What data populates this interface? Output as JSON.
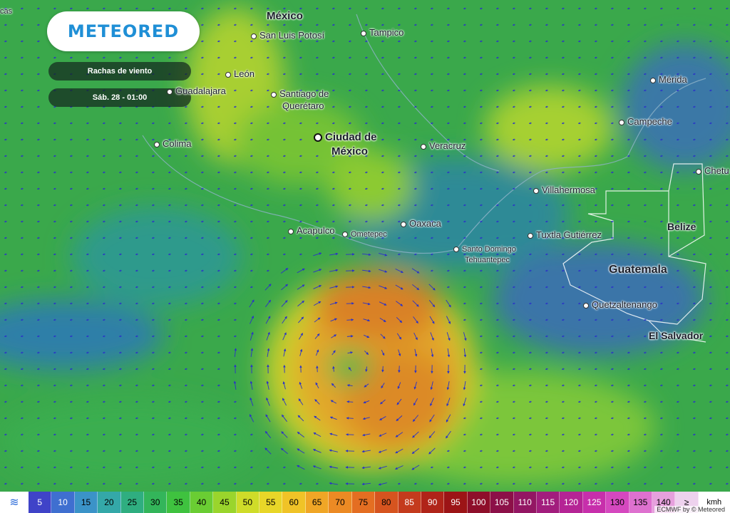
{
  "brand": {
    "logo_text": "METEORED"
  },
  "panel": {
    "layer_label": "Rachas de viento",
    "time_label": "Sáb. 28 - 01:00"
  },
  "map": {
    "cities": [
      {
        "name": "México",
        "style": "big",
        "dot": false
      },
      {
        "name": "San Luis Potosí",
        "style": "normal",
        "dot": true
      },
      {
        "name": "Tampico",
        "style": "normal",
        "dot": true
      },
      {
        "name": "León",
        "style": "normal",
        "dot": true
      },
      {
        "name": "Guadalajara",
        "style": "normal",
        "dot": true
      },
      {
        "name": "Santiago de",
        "style": "normal",
        "dot": true
      },
      {
        "name": "Querétaro",
        "style": "normal",
        "dot": false
      },
      {
        "name": "Mérida",
        "style": "normal",
        "dot": true
      },
      {
        "name": "Campeche",
        "style": "normal",
        "dot": true
      },
      {
        "name": "Ciudad de",
        "style": "big",
        "dot": true
      },
      {
        "name": "México",
        "style": "big",
        "dot": false
      },
      {
        "name": "Colima",
        "style": "normal",
        "dot": true
      },
      {
        "name": "Veracruz",
        "style": "normal",
        "dot": true
      },
      {
        "name": "Villahermosa",
        "style": "normal",
        "dot": true
      },
      {
        "name": "Chetu",
        "style": "normal",
        "dot": true
      },
      {
        "name": "Acapulco",
        "style": "normal",
        "dot": true
      },
      {
        "name": "Ometepec",
        "style": "small",
        "dot": true
      },
      {
        "name": "Oaxaca",
        "style": "normal",
        "dot": true
      },
      {
        "name": "Santo Domingo",
        "style": "small",
        "dot": true
      },
      {
        "name": "Tehuantepec",
        "style": "small",
        "dot": false
      },
      {
        "name": "Tuxtla Gutiérrez",
        "style": "normal",
        "dot": true
      },
      {
        "name": "Belize",
        "style": "country",
        "dot": false
      },
      {
        "name": "Guatemala",
        "style": "country",
        "dot": false
      },
      {
        "name": "Quetzaltenango",
        "style": "normal",
        "dot": true
      },
      {
        "name": "El Salvador",
        "style": "country",
        "dot": false
      },
      {
        "name": "cas",
        "style": "small",
        "dot": false
      }
    ]
  },
  "legend": {
    "values": [
      "5",
      "10",
      "15",
      "20",
      "25",
      "30",
      "35",
      "40",
      "45",
      "50",
      "55",
      "60",
      "65",
      "70",
      "75",
      "80",
      "85",
      "90",
      "95",
      "100",
      "105",
      "110",
      "115",
      "120",
      "125",
      "130",
      "135",
      "140",
      "≥"
    ],
    "colors": [
      "#3f43c8",
      "#3f6fd0",
      "#3b93c8",
      "#34a8a8",
      "#2fae80",
      "#33b55a",
      "#3fc23f",
      "#6acd33",
      "#9ad52c",
      "#cfdc29",
      "#e8d628",
      "#f0c327",
      "#f0a626",
      "#ec8a24",
      "#e46e22",
      "#d6541f",
      "#c43b1d",
      "#b02419",
      "#9c1416",
      "#8e0f2a",
      "#8c1048",
      "#931663",
      "#a21d7d",
      "#b52495",
      "#c72fab",
      "#d548bf",
      "#de71cf",
      "#e6a0dd",
      "#eed2ee"
    ],
    "unit": "kmh",
    "icon": "wind-icon"
  },
  "credit": "ECMWF by © Meteored"
}
